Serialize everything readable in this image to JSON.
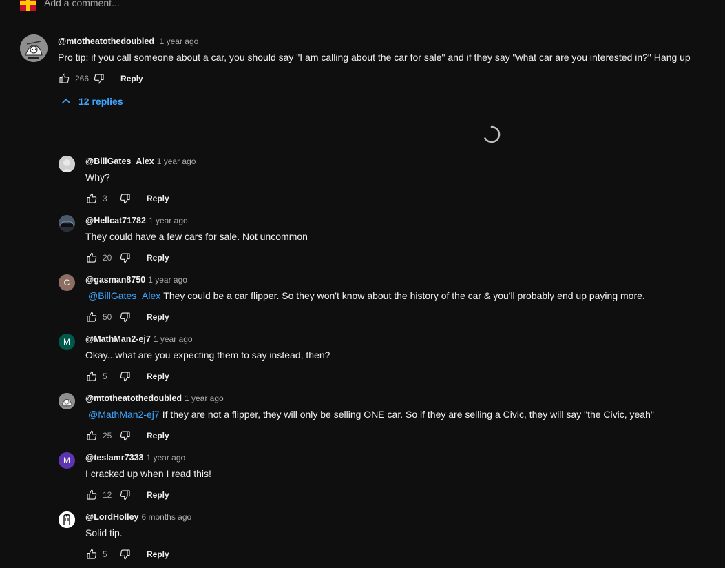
{
  "add_comment": {
    "placeholder": "Add a comment..."
  },
  "top_comment": {
    "author": "@mtotheatothedoubled",
    "time": "1 year ago",
    "text": "Pro tip: if you call someone about a car, you should say \"I am calling about the car for sale\" and if they say \"what car are you interested in?\"  Hang up",
    "likes": "266",
    "reply_label": "Reply",
    "avatar_icon": "sketch-avatar"
  },
  "replies_toggle": {
    "label": "12 replies",
    "icon": "chevron-up-icon",
    "color": "#3ea6ff"
  },
  "loading": {
    "icon": "loading-spinner"
  },
  "replies": [
    {
      "author": "@BillGates_Alex",
      "time": "1 year ago",
      "mention": "",
      "text": "Why?",
      "likes": "3",
      "reply_label": "Reply",
      "avatar_letter": "",
      "avatar_color": "#cccccc",
      "avatar_icon": "default-person-avatar"
    },
    {
      "author": "@Hellcat71782",
      "time": "1 year ago",
      "mention": "",
      "text": "They could have a few cars for sale. Not uncommon",
      "likes": "20",
      "reply_label": "Reply",
      "avatar_letter": "",
      "avatar_color": "#2d3a4a",
      "avatar_icon": "car-photo-avatar"
    },
    {
      "author": "@gasman8750",
      "time": "1 year ago",
      "mention": "@BillGates_Alex",
      "text": "They could be a car flipper. So they won't know about the history of the car & you'll probably end up paying more.",
      "likes": "50",
      "reply_label": "Reply",
      "avatar_letter": "C",
      "avatar_color": "#8d6e63",
      "avatar_icon": "letter-avatar"
    },
    {
      "author": "@MathMan2-ej7",
      "time": "1 year ago",
      "mention": "",
      "text": "Okay...what are you expecting them to say instead, then?",
      "likes": "5",
      "reply_label": "Reply",
      "avatar_letter": "M",
      "avatar_color": "#00594a",
      "avatar_icon": "letter-avatar"
    },
    {
      "author": "@mtotheatothedoubled",
      "time": "1 year ago",
      "mention": "@MathMan2-ej7",
      "text": "If they are not a flipper, they will only be selling ONE car.  So if they are selling a Civic, they will say \"the Civic, yeah\"",
      "likes": "25",
      "reply_label": "Reply",
      "avatar_letter": "",
      "avatar_color": "#9a9a9a",
      "avatar_icon": "sketch-avatar"
    },
    {
      "author": "@teslamr7333",
      "time": "1 year ago",
      "mention": "",
      "text": "I cracked up when I read this!",
      "likes": "12",
      "reply_label": "Reply",
      "avatar_letter": "M",
      "avatar_color": "#5e35b1",
      "avatar_icon": "letter-avatar"
    },
    {
      "author": "@LordHolley",
      "time": "6 months ago",
      "mention": "",
      "text": "Solid tip.",
      "likes": "5",
      "reply_label": "Reply",
      "avatar_letter": "",
      "avatar_color": "#ffffff",
      "avatar_icon": "drawing-avatar"
    }
  ],
  "colors": {
    "background": "#0f0f0f",
    "text": "#f1f1f1",
    "secondary_text": "#aaaaaa",
    "link": "#3ea6ff"
  }
}
